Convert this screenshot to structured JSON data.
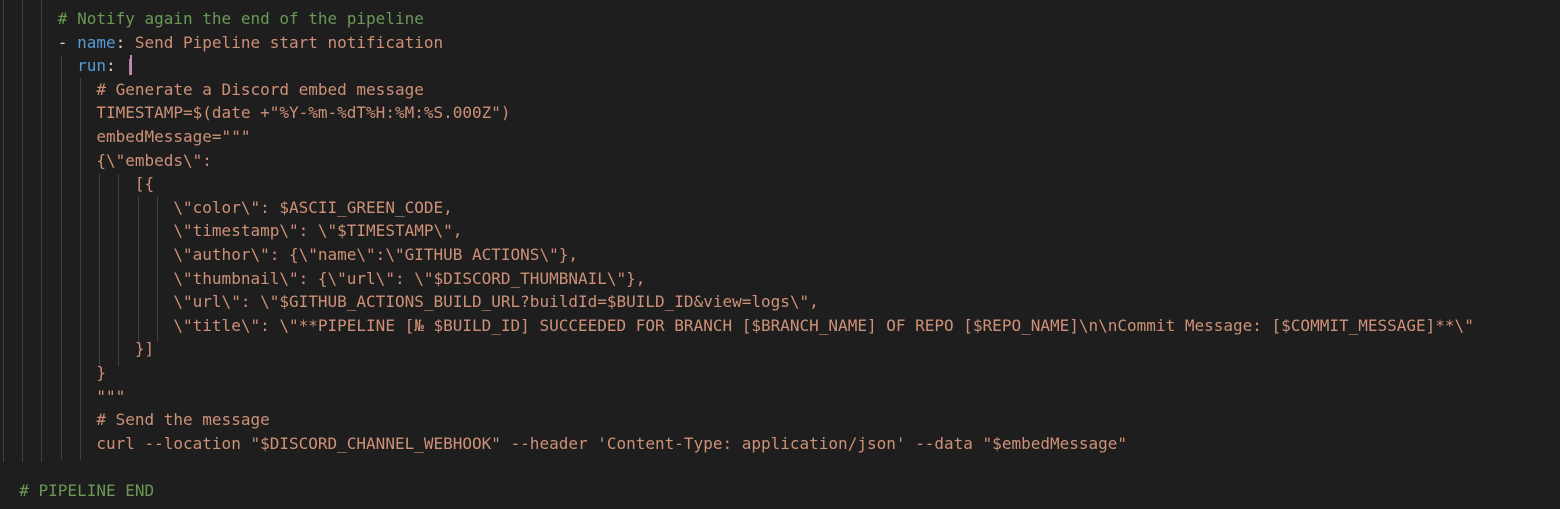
{
  "editor": {
    "language": "yaml",
    "colors": {
      "background": "#1e1e1e",
      "comment": "#6a9955",
      "key": "#569cd6",
      "string": "#ce9178",
      "punctuation": "#d4d4d4"
    },
    "lines": [
      {
        "indent": "      ",
        "parts": [
          {
            "t": "comment",
            "s": "# Notify again the end of the pipeline"
          }
        ]
      },
      {
        "indent": "      ",
        "parts": [
          {
            "t": "punct",
            "s": "- "
          },
          {
            "t": "key",
            "s": "name"
          },
          {
            "t": "punct",
            "s": ": "
          },
          {
            "t": "str",
            "s": "Send Pipeline start notification"
          }
        ]
      },
      {
        "indent": "        ",
        "parts": [
          {
            "t": "key",
            "s": "run"
          },
          {
            "t": "punct",
            "s": ": "
          },
          {
            "t": "bar",
            "s": "|"
          }
        ]
      },
      {
        "indent": "          ",
        "parts": [
          {
            "t": "str",
            "s": "# Generate a Discord embed message"
          }
        ]
      },
      {
        "indent": "          ",
        "parts": [
          {
            "t": "str",
            "s": "TIMESTAMP=$(date +\"%Y-%m-%dT%H:%M:%S.000Z\")"
          }
        ]
      },
      {
        "indent": "          ",
        "parts": [
          {
            "t": "str",
            "s": "embedMessage=\"\"\""
          }
        ]
      },
      {
        "indent": "          ",
        "parts": [
          {
            "t": "str",
            "s": "{\\\"embeds\\\":"
          }
        ]
      },
      {
        "indent": "              ",
        "parts": [
          {
            "t": "str",
            "s": "[{"
          }
        ]
      },
      {
        "indent": "                  ",
        "parts": [
          {
            "t": "str",
            "s": "\\\"color\\\": $ASCII_GREEN_CODE,"
          }
        ]
      },
      {
        "indent": "                  ",
        "parts": [
          {
            "t": "str",
            "s": "\\\"timestamp\\\": \\\"$TIMESTAMP\\\","
          }
        ]
      },
      {
        "indent": "                  ",
        "parts": [
          {
            "t": "str",
            "s": "\\\"author\\\": {\\\"name\\\":\\\"GITHUB ACTIONS\\\"},"
          }
        ]
      },
      {
        "indent": "                  ",
        "parts": [
          {
            "t": "str",
            "s": "\\\"thumbnail\\\": {\\\"url\\\": \\\"$DISCORD_THUMBNAIL\\\"},"
          }
        ]
      },
      {
        "indent": "                  ",
        "parts": [
          {
            "t": "str",
            "s": "\\\"url\\\": \\\"$GITHUB_ACTIONS_BUILD_URL?buildId=$BUILD_ID&view=logs\\\","
          }
        ]
      },
      {
        "indent": "                  ",
        "parts": [
          {
            "t": "str",
            "s": "\\\"title\\\": \\\"**PIPELINE [№ $BUILD_ID] SUCCEEDED FOR BRANCH [$BRANCH_NAME] OF REPO [$REPO_NAME]\\n\\nCommit Message: [$COMMIT_MESSAGE]**\\\""
          }
        ]
      },
      {
        "indent": "              ",
        "parts": [
          {
            "t": "str",
            "s": "}]"
          }
        ]
      },
      {
        "indent": "          ",
        "parts": [
          {
            "t": "str",
            "s": "}"
          }
        ]
      },
      {
        "indent": "          ",
        "parts": [
          {
            "t": "str",
            "s": "\"\"\""
          }
        ]
      },
      {
        "indent": "          ",
        "parts": [
          {
            "t": "str",
            "s": "# Send the message"
          }
        ]
      },
      {
        "indent": "          ",
        "parts": [
          {
            "t": "str",
            "s": "curl --location \"$DISCORD_CHANNEL_WEBHOOK\" --header 'Content-Type: application/json' --data \"$embedMessage\""
          }
        ]
      },
      {
        "indent": "",
        "parts": []
      },
      {
        "indent": "  ",
        "parts": [
          {
            "t": "comment",
            "s": "# PIPELINE END"
          }
        ]
      }
    ]
  }
}
